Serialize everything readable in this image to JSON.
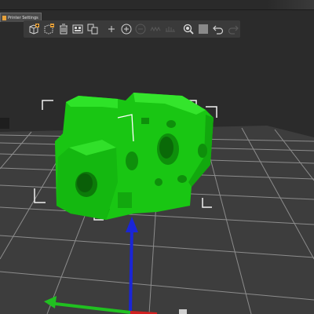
{
  "tab": {
    "label": "Printer Settings"
  },
  "toolbar": {
    "buttons": [
      {
        "name": "add-icon"
      },
      {
        "name": "delete-icon"
      },
      {
        "name": "delete-all-icon"
      },
      {
        "name": "arrange-icon"
      },
      {
        "name": "copy-icon"
      },
      {
        "name": "paste-icon"
      },
      {
        "name": "add-instance-icon"
      },
      {
        "name": "remove-instance-icon"
      },
      {
        "name": "split-objects-icon"
      },
      {
        "name": "split-parts-icon"
      },
      {
        "name": "search-icon"
      },
      {
        "name": "layers-editing-icon"
      },
      {
        "name": "undo-icon"
      },
      {
        "name": "redo-icon"
      }
    ]
  },
  "colors": {
    "model": "#19c613",
    "bed": "#3a3a3a",
    "grid": "#8a8a8a",
    "axis_z": "#1a25d6",
    "axis_y": "#20c020",
    "axis_x": "#d02020",
    "accent": "#e8a23a"
  }
}
